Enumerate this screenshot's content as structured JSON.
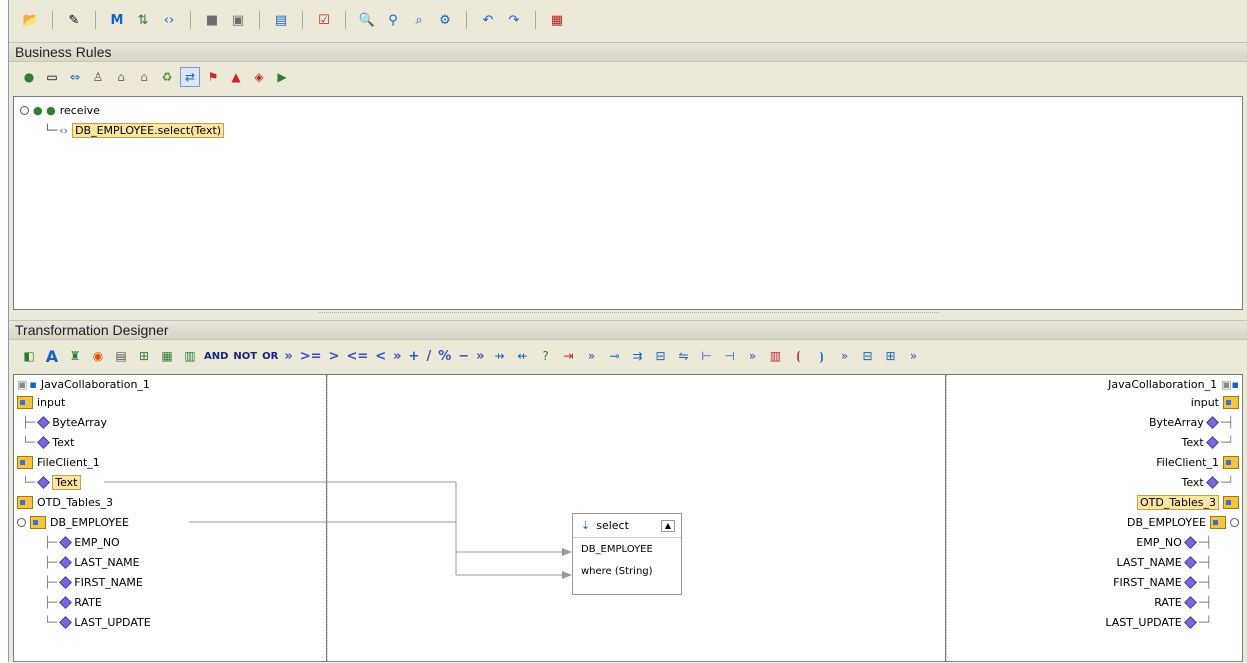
{
  "top_toolbar": {
    "icons": [
      "open-icon",
      "edit-icon",
      "mapper-icon",
      "collaboration-icon",
      "code-icon",
      "collapse-icon",
      "expand-icon",
      "panel-icon",
      "validate-icon",
      "zoom-in-icon",
      "zoom-out-icon",
      "find-icon",
      "settings-icon",
      "undo-icon",
      "redo-icon",
      "jar-icon"
    ]
  },
  "business_rules": {
    "title": "Business Rules",
    "tree": {
      "root_label": "receive",
      "child_label": "DB_EMPLOYEE.select(Text)"
    }
  },
  "transformation_designer": {
    "title": "Transformation Designer",
    "operator_labels": [
      "AND",
      "NOT",
      "OR",
      "»",
      ">=",
      ">",
      "<=",
      "<",
      "»",
      "+",
      "/",
      "%",
      "−",
      "»"
    ],
    "left_tree": {
      "root": "JavaCollaboration_1",
      "items": [
        {
          "label": "input",
          "type": "folder"
        },
        {
          "label": "ByteArray",
          "type": "leaf"
        },
        {
          "label": "Text",
          "type": "leaf"
        },
        {
          "label": "FileClient_1",
          "type": "folder"
        },
        {
          "label": "Text",
          "type": "leaf",
          "selected": true
        },
        {
          "label": "OTD_Tables_3",
          "type": "folder"
        },
        {
          "label": "DB_EMPLOYEE",
          "type": "folder"
        },
        {
          "label": "EMP_NO",
          "type": "leaf"
        },
        {
          "label": "LAST_NAME",
          "type": "leaf"
        },
        {
          "label": "FIRST_NAME",
          "type": "leaf"
        },
        {
          "label": "RATE",
          "type": "leaf"
        },
        {
          "label": "LAST_UPDATE",
          "type": "leaf"
        }
      ]
    },
    "right_tree": {
      "root": "JavaCollaboration_1",
      "items": [
        {
          "label": "input",
          "type": "folder"
        },
        {
          "label": "ByteArray",
          "type": "leaf"
        },
        {
          "label": "Text",
          "type": "leaf"
        },
        {
          "label": "FileClient_1",
          "type": "folder"
        },
        {
          "label": "Text",
          "type": "leaf"
        },
        {
          "label": "OTD_Tables_3",
          "type": "folder",
          "selected": true
        },
        {
          "label": "DB_EMPLOYEE",
          "type": "folder"
        },
        {
          "label": "EMP_NO",
          "type": "leaf"
        },
        {
          "label": "LAST_NAME",
          "type": "leaf"
        },
        {
          "label": "FIRST_NAME",
          "type": "leaf"
        },
        {
          "label": "RATE",
          "type": "leaf"
        },
        {
          "label": "LAST_UPDATE",
          "type": "leaf"
        }
      ]
    },
    "method_box": {
      "title": "select",
      "params": [
        "DB_EMPLOYEE",
        "where (String)"
      ]
    }
  }
}
